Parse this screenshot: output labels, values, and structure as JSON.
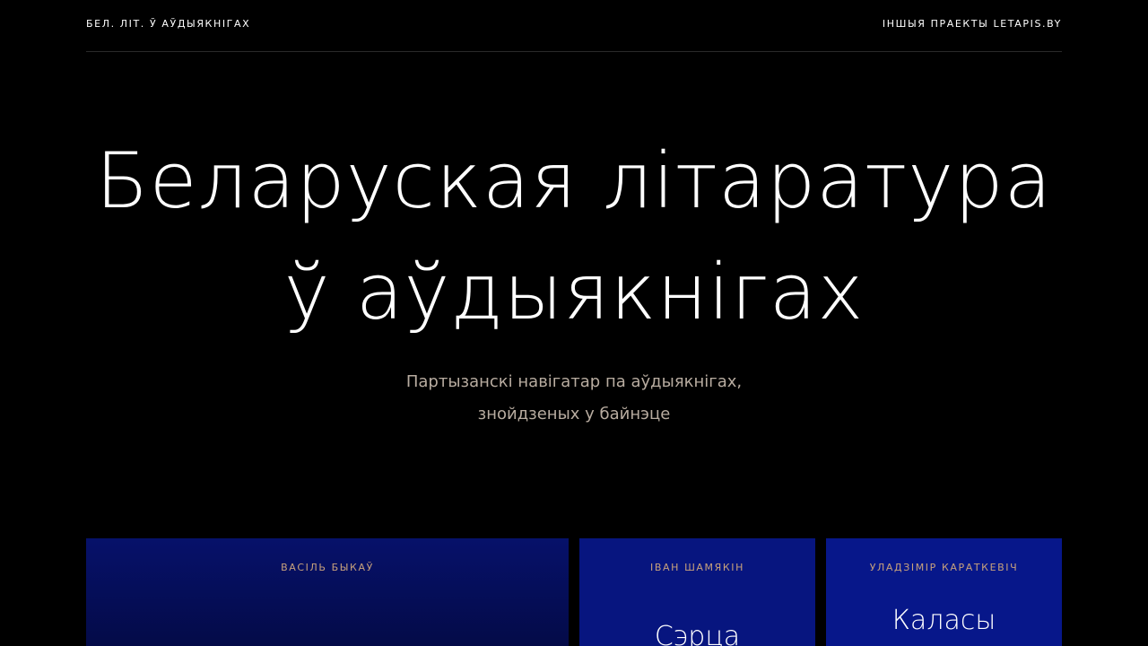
{
  "header": {
    "site_title": "БЕЛ. ЛІТ. Ў АЎДЫЯКНІГАХ",
    "other_projects": "ІНШЫЯ ПРАЕКТЫ LETAPIS.BY"
  },
  "hero": {
    "title_line1": "Беларуская літаратура",
    "title_line2": "ў аўдыякнігах",
    "subtitle_line1": "Партызанскі навігатар па аўдыякнігах,",
    "subtitle_line2": "знойдзеных у байнэце"
  },
  "cards": [
    {
      "author": "ВАСІЛЬ БЫКАЎ",
      "title": ""
    },
    {
      "author": "ІВАН ШАМЯКІН",
      "title": "Сэрца"
    },
    {
      "author": "УЛАДЗІМІР КАРАТКЕВІЧ",
      "title": "Каласы"
    }
  ],
  "colors": {
    "background": "#000000",
    "accent_gold": "#c8a27c",
    "card_blue": "#07157f"
  }
}
